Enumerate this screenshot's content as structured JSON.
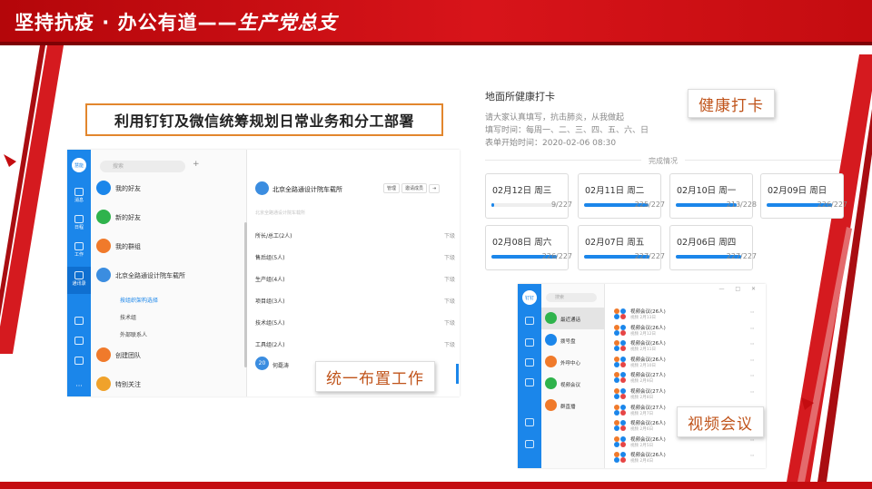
{
  "header": {
    "title_main": "坚持抗疫 · 办公有道——",
    "title_italic": "生产党总支"
  },
  "caption": "利用钉钉及微信统筹规划日常业务和分工部署",
  "labels": {
    "health": "健康打卡",
    "work": "统一布置工作",
    "video": "视频会议"
  },
  "dingtalk": {
    "avatar": "慧能",
    "search_placeholder": "搜索",
    "plus": "+",
    "rail": [
      {
        "label": "消息",
        "icon": "message-icon"
      },
      {
        "label": "日程",
        "icon": "calendar-icon"
      },
      {
        "label": "工作",
        "icon": "apps-icon"
      },
      {
        "label": "通讯录",
        "icon": "contacts-icon"
      }
    ],
    "list": [
      {
        "label": "我的好友",
        "color": "#1b86ea"
      },
      {
        "label": "新的好友",
        "color": "#2fb34c"
      },
      {
        "label": "我的群组",
        "color": "#f07a2b"
      },
      {
        "label": "北京全路通设计院车载所",
        "color": "#3b8de0"
      },
      {
        "label": "创建团队",
        "color": "#f07a2b"
      },
      {
        "label": "特别关注",
        "color": "#f0a22b"
      }
    ],
    "sublist": [
      {
        "label": "按组织架构选择"
      },
      {
        "label": "技术组"
      },
      {
        "label": "外部联系人"
      }
    ],
    "org": {
      "title": "北京全路通设计院车载所",
      "btn_manage": "管理",
      "btn_invite": "邀请成员",
      "hint": "北京全路通设计院车载所",
      "departments": [
        {
          "name": "所长/总工(2人)",
          "action": "下级"
        },
        {
          "name": "售后组(5人)",
          "action": "下级"
        },
        {
          "name": "生产组(4人)",
          "action": "下级"
        },
        {
          "name": "项目组(3人)",
          "action": "下级"
        },
        {
          "name": "技术组(5人)",
          "action": "下级"
        },
        {
          "name": "工具组(2人)",
          "action": "下级"
        }
      ],
      "count": "20",
      "count_label": "何磊涛"
    }
  },
  "health": {
    "title": "地面所健康打卡",
    "lines": [
      "请大家认真填写，抗击肺炎，从我做起",
      "填写时间：每周一、二、三、四、五、六、日",
      "表单开始时间：2020-02-06 08:30"
    ],
    "done_label": "完成情况",
    "days": [
      {
        "date": "02月12日 周三",
        "count": "9/227",
        "fraction": 0.04
      },
      {
        "date": "02月11日 周二",
        "count": "225/227",
        "fraction": 0.99
      },
      {
        "date": "02月10日 周一",
        "count": "213/228",
        "fraction": 0.93
      },
      {
        "date": "02月09日 周日",
        "count": "226/227",
        "fraction": 0.995
      },
      {
        "date": "02月08日 周六",
        "count": "226/227",
        "fraction": 0.995
      },
      {
        "date": "02月07日 周五",
        "count": "227/227",
        "fraction": 1.0
      },
      {
        "date": "02月06日 周四",
        "count": "227/227",
        "fraction": 1.0
      }
    ]
  },
  "video": {
    "avatar": "钉钉",
    "search_placeholder": "搜索",
    "window_controls": "— □ ✕",
    "list": [
      {
        "label": "最近通话",
        "color": "#2fb34c"
      },
      {
        "label": "拨号盘",
        "color": "#1b86ea"
      },
      {
        "label": "外呼中心",
        "color": "#f07a2b"
      },
      {
        "label": "视频会议",
        "color": "#2fb34c"
      },
      {
        "label": "群直播",
        "color": "#f07a2b"
      }
    ],
    "meetings": [
      {
        "name": "视频会议(26人)",
        "sub": "视频 2月13日"
      },
      {
        "name": "视频会议(26人)",
        "sub": "视频 2月12日"
      },
      {
        "name": "视频会议(26人)",
        "sub": "视频 2月11日"
      },
      {
        "name": "视频会议(26人)",
        "sub": "视频 2月10日"
      },
      {
        "name": "视频会议(27人)",
        "sub": "视频 2月9日"
      },
      {
        "name": "视频会议(27人)",
        "sub": "视频 2月8日"
      },
      {
        "name": "视频会议(27人)",
        "sub": "视频 2月7日"
      },
      {
        "name": "视频会议(26人)",
        "sub": "视频 2月6日"
      },
      {
        "name": "视频会议(26人)",
        "sub": "视频 2月5日"
      },
      {
        "name": "视频会议(26人)",
        "sub": "视频 2月4日"
      }
    ]
  },
  "colors": {
    "banner_red": "#c40c10",
    "accent_orange": "#e2862d",
    "dingtalk_blue": "#1b86ea"
  }
}
